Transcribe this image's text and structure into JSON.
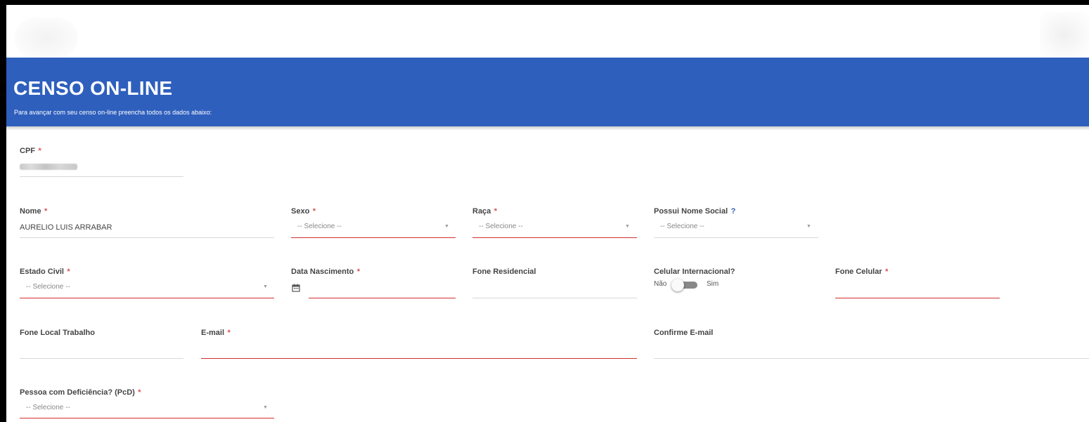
{
  "header": {
    "title": "CENSO ON-LINE",
    "subtitle": "Para avançar com seu censo on-line preencha todos os dados abaixo:"
  },
  "form": {
    "required_mark": "*",
    "help_mark": "?",
    "cpf": {
      "label": "CPF"
    },
    "nome": {
      "label": "Nome",
      "value": "AURELIO LUIS ARRABAR"
    },
    "sexo": {
      "label": "Sexo",
      "placeholder": "-- Selecione --"
    },
    "raca": {
      "label": "Raça",
      "placeholder": "-- Selecione --"
    },
    "nome_social": {
      "label": "Possui Nome Social",
      "placeholder": "-- Selecione --"
    },
    "estado_civil": {
      "label": "Estado Civil",
      "placeholder": "-- Selecione --"
    },
    "data_nascimento": {
      "label": "Data Nascimento",
      "value": ""
    },
    "fone_residencial": {
      "label": "Fone Residencial",
      "value": ""
    },
    "celular_internacional": {
      "label": "Celular Internacional?",
      "off_label": "Não",
      "on_label": "Sim",
      "checked": false
    },
    "fone_celular": {
      "label": "Fone Celular",
      "value": ""
    },
    "fone_trabalho": {
      "label": "Fone Local Trabalho",
      "value": ""
    },
    "email": {
      "label": "E-mail",
      "value": ""
    },
    "confirme_email": {
      "label": "Confirme E-mail",
      "value": ""
    },
    "pcd": {
      "label": "Pessoa com Deficiência? (PcD)",
      "placeholder": "-- Selecione --"
    }
  },
  "colors": {
    "banner": "#2e5fbd",
    "required": "#d9534f",
    "error_line": "#d32f2f"
  },
  "icons": {
    "calendar": "calendar-icon",
    "caret": "chevron-down-icon"
  }
}
